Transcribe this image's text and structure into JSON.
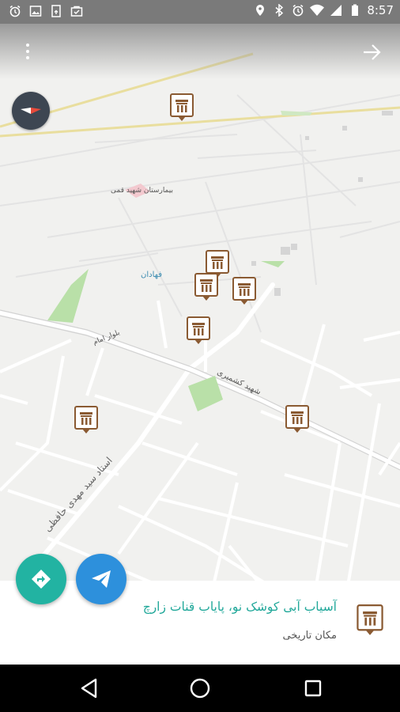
{
  "status_bar": {
    "time": "8:57",
    "left_icons": [
      "alarm-icon",
      "image-icon",
      "sim-card-icon",
      "store-icon"
    ],
    "right_icons": [
      "location-icon",
      "bluetooth-icon",
      "alarm-icon",
      "wifi-icon",
      "signal-icon",
      "battery-icon"
    ]
  },
  "map": {
    "labels": {
      "place_hospital": "بیمارستان شهید قمی",
      "place_town": "فهادان",
      "street_1": "بلوار امام",
      "street_2": "شهید کشمیری",
      "street_3": "استاد سید مهدی حافظی"
    }
  },
  "info_card": {
    "title": "آسیاب آبی کوشک نو، پایاب قنات زارچ",
    "subtitle": "مکان تاریخی"
  },
  "colors": {
    "direction_fab": "#22b3a2",
    "share_fab": "#2d90dc",
    "title_text": "#21a89a",
    "marker_brown": "#8a5a32"
  }
}
